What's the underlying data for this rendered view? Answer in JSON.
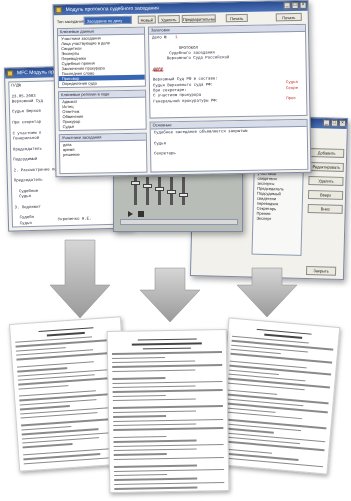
{
  "main_window": {
    "title": "Модуль протокола судебного заседания",
    "toolbar": {
      "type_label": "Тип заседания",
      "type_value": "Заседание по делу",
      "buttons": [
        "Новый",
        "Удалить",
        "Предварительный",
        "Печать",
        "Печать"
      ]
    },
    "left_tree_header": "Ключевые данные",
    "tree_items": [
      "Участники заседания",
      "Лица участвующие в деле",
      "Свидетели",
      "Эксперты",
      "Переводчики",
      "Судебные прения",
      "Заключение прокурора",
      "Последнее слово",
      "Приговор",
      "Определения суда",
      "Представители",
      "Ходатайства",
      "Отводы",
      "Разное"
    ],
    "list2_header": "Ключевые реплики в ходе",
    "list2_items": [
      "Адвокат",
      "Истец",
      "Ответчик",
      "Обвинение",
      "Прокурор",
      "Судья"
    ],
    "list3_header": "Участники заседания",
    "list3_items": [
      "дата",
      "время",
      "решение"
    ],
    "text_header": "Заголовок",
    "text_lines": [
      "Дело № ",
      "",
      "           ПРОТОКОЛ",
      "       Судебного заседания",
      "      Верховного Суда Российской",
      "",
      "дата",
      "",
      "Верховный Суд РФ в составе:",
      "Судья Верховного суда РФ:",
      "При секретаре:",
      "С участием прокурора",
      "Генеральной прокуратуры РФ:"
    ],
    "text_red": [
      "1",
      "дата",
      "Судья",
      "Секре",
      "Прок"
    ],
    "lower_header": "Основные",
    "lower_lines": [
      "Судебное заседание объявляется закрытым",
      "",
      "Судья",
      "",
      "Секретарь"
    ]
  },
  "back_window": {
    "title": "MFC Модуль протокола",
    "lines": [
      "П/Д№",
      "",
      "23.05.2003",
      "Верховный Суд",
      "",
      "Судья Верхов",
      "",
      "При секретар",
      "",
      "С участием п",
      "Генеральной",
      "",
      "Председатель",
      "",
      "Подсудимый",
      "",
      "2. Рассмотрение по делу",
      "",
      "Председатель",
      "",
      "  Судебные",
      "  Судья",
      "",
      "3. Подлежит",
      "",
      "  Судебн",
      "  Судья"
    ],
    "signature": "Укрепенко Н.Е."
  },
  "right_window": {
    "buttons": [
      "Добавить",
      "Редактировать",
      "Удалить",
      "Вверх",
      "Вниз"
    ],
    "list": [
      "дата",
      "время",
      "судебное заседание",
      "Судебное",
      "Доклад",
      "участники",
      "свидетели",
      "эксперты",
      "Председатель",
      "Подсудимый",
      "свидетели",
      "переводчик",
      "Секретарь",
      "Прения",
      "Эксперт"
    ],
    "close": "Закрыть"
  },
  "mixer": {
    "sliders": 5
  },
  "documents": [
    {
      "title": "ПРОТОКОЛ"
    },
    {
      "title": "ПРОТОКОЛ"
    },
    {
      "title": "ПРОТОКОЛ"
    }
  ]
}
